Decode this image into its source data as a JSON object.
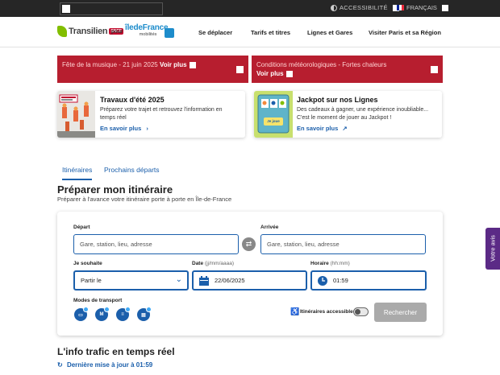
{
  "topbar": {
    "accessibility": "ACCESSIBILITÉ",
    "language": "FRANÇAIS"
  },
  "header": {
    "logo_transilien": "Transilien",
    "logo_sncf": "SNCF",
    "logo_pour": "pour",
    "logo_idf": "îledeFrance",
    "logo_idf_sub": "mobilités",
    "nav": [
      "Se déplacer",
      "Tarifs et titres",
      "Lignes et Gares",
      "Visiter Paris et sa Région"
    ]
  },
  "alerts": [
    {
      "text": "Fête de la musique - 21 juin 2025",
      "more": "Voir plus"
    },
    {
      "text": "Conditions météorologiques - Fortes chaleurs",
      "more": "Voir plus"
    }
  ],
  "promos": [
    {
      "title": "Travaux d'été 2025",
      "desc": "Préparez votre trajet et retrouvez l'information en temps réel",
      "link": "En savoir plus",
      "link_icon": "chevron-right-icon"
    },
    {
      "title": "Jackpot sur nos Lignes",
      "desc": "Des cadeaux à gagner, une expérience inoubliable... C'est le moment de jouer au Jackpot !",
      "link": "En savoir plus",
      "link_icon": "external-link-icon",
      "image_label": "Je joue"
    }
  ],
  "tabs": [
    "Itinéraires",
    "Prochains départs"
  ],
  "planner": {
    "title": "Préparer mon itinéraire",
    "subtitle": "Préparer à l'avance votre itinéraire porte à porte en Île-de-France",
    "depart_label": "Départ",
    "depart_placeholder": "Gare, station, lieu, adresse",
    "arrivee_label": "Arrivée",
    "arrivee_placeholder": "Gare, station, lieu, adresse",
    "souhaite_label": "Je souhaite",
    "souhaite_value": "Partir le",
    "date_label": "Date",
    "date_hint": "(jj/mm/aaaa)",
    "date_value": "22/06/2025",
    "horaire_label": "Horaire",
    "horaire_hint": "(hh:mm)",
    "horaire_value": "01:59",
    "modes_label": "Modes de transport",
    "modes": [
      "train-icon",
      "metro-icon",
      "tram-icon",
      "bus-icon"
    ],
    "accessible_label": "Itinéraires accessibles",
    "search_button": "Rechercher"
  },
  "traffic": {
    "title": "L'info trafic en temps réel",
    "update": "Dernière mise à jour à 01:59"
  },
  "feedback": "Votre avis",
  "colors": {
    "alert_red": "#b71e2f",
    "primary_blue": "#1b5fab",
    "topbar": "#262626",
    "feedback_purple": "#5b2a86"
  }
}
